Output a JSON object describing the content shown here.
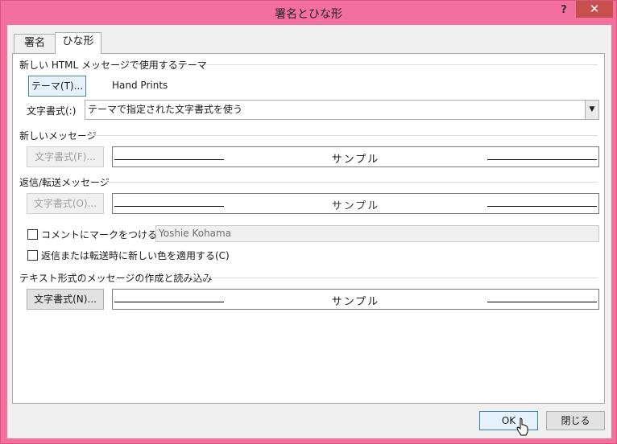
{
  "window": {
    "title": "署名とひな形",
    "help": "?",
    "close": "✕"
  },
  "tabs": [
    {
      "label": "署名"
    },
    {
      "label": "ひな形"
    }
  ],
  "theme_section": {
    "heading": "新しい HTML メッセージで使用するテーマ",
    "theme_button": "テーマ(T)...",
    "theme_value": "Hand Prints",
    "font_label": "文字書式(:)",
    "font_select_value": "テーマで指定された文字書式を使う"
  },
  "new_msg_section": {
    "heading": "新しいメッセージ",
    "font_button": "文字書式(F)...",
    "sample": "サンプル"
  },
  "reply_section": {
    "heading": "返信/転送メッセージ",
    "font_button": "文字書式(O)...",
    "sample": "サンプル",
    "mark_comments_label": "コメントにマークをつける(M):",
    "mark_comments_value": "Yoshie Kohama",
    "new_color_label": "返信または転送時に新しい色を適用する(C)"
  },
  "plain_section": {
    "heading": "テキスト形式のメッセージの作成と読み込み",
    "font_button": "文字書式(N)...",
    "sample": "サンプル"
  },
  "footer": {
    "ok": "OK",
    "close": "閉じる"
  },
  "colors": {
    "title_bar": "#f36f9d",
    "close_button": "#c7504f"
  }
}
